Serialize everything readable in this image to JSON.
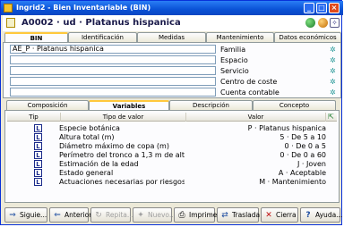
{
  "window": {
    "title": "Ingrid2 - Bien Inventariable (BIN)",
    "buttons": {
      "minimize": "_",
      "maximize": "□",
      "close": "×"
    }
  },
  "header": {
    "record_title": "A0002 · ud · Platanus hispanica",
    "icons": [
      "globe-icon",
      "person-icon",
      "link-icon"
    ]
  },
  "main_tabs": [
    {
      "label": "BIN",
      "active": true
    },
    {
      "label": "Identificación",
      "active": false
    },
    {
      "label": "Medidas",
      "active": false
    },
    {
      "label": "Mantenimiento",
      "active": false
    },
    {
      "label": "Datos económicos",
      "active": false
    }
  ],
  "fields": [
    {
      "value": "AE_P · Platanus hispanica",
      "label": "Familia"
    },
    {
      "value": "",
      "label": "Espacio"
    },
    {
      "value": "",
      "label": "Servicio"
    },
    {
      "value": "",
      "label": "Centro de coste"
    },
    {
      "value": "",
      "label": "Cuenta contable"
    }
  ],
  "sub_tabs": [
    {
      "label": "Composición",
      "active": false
    },
    {
      "label": "Variables",
      "active": true
    },
    {
      "label": "Descripción",
      "active": false
    },
    {
      "label": "Concepto",
      "active": false
    }
  ],
  "table": {
    "headers": {
      "tip": "Tip",
      "tipo": "Tipo de valor",
      "valor": "Valor"
    },
    "rows": [
      {
        "tip": "L",
        "tipo": "Especie botánica",
        "valor": "P · Platanus hispanica"
      },
      {
        "tip": "L",
        "tipo": "Altura total (m)",
        "valor": "5 · De 5 a 10"
      },
      {
        "tip": "L",
        "tipo": "Diámetro máximo de copa (m)",
        "valor": "0 · De 0 a 5"
      },
      {
        "tip": "L",
        "tipo": "Perímetro del tronco a 1,3 m de altu...",
        "valor": "0 · De 0 a 60"
      },
      {
        "tip": "L",
        "tipo": "Estimación de la edad",
        "valor": "J · Joven"
      },
      {
        "tip": "L",
        "tipo": "Estado general",
        "valor": "A · Aceptable"
      },
      {
        "tip": "L",
        "tipo": "Actuaciones necesarias por riesgos",
        "valor": "M · Mantenimiento"
      }
    ]
  },
  "toolbar": [
    {
      "label": "Siguie...",
      "icon": "next-icon",
      "glyph": "⇒",
      "enabled": true
    },
    {
      "label": "Anterior",
      "icon": "back-arrow-icon",
      "glyph": "⇐",
      "enabled": true
    },
    {
      "label": "Repita...",
      "icon": "repeat-icon",
      "glyph": "↻",
      "enabled": false
    },
    {
      "label": "Nuevo...",
      "icon": "new-icon",
      "glyph": "✦",
      "enabled": false
    },
    {
      "label": "Imprime",
      "icon": "printer-icon",
      "glyph": "⎙",
      "enabled": true
    },
    {
      "label": "Traslada",
      "icon": "transfer-icon",
      "glyph": "⇄",
      "enabled": true
    },
    {
      "label": "Cierra",
      "icon": "close-icon",
      "glyph": "✕",
      "enabled": true
    },
    {
      "label": "Ayuda...",
      "icon": "help-icon",
      "glyph": "?",
      "enabled": true
    }
  ],
  "colors": {
    "accent": "#0a52d6",
    "tab_highlight": "#ffc83c",
    "settings_icon": "#2a9a9a"
  }
}
